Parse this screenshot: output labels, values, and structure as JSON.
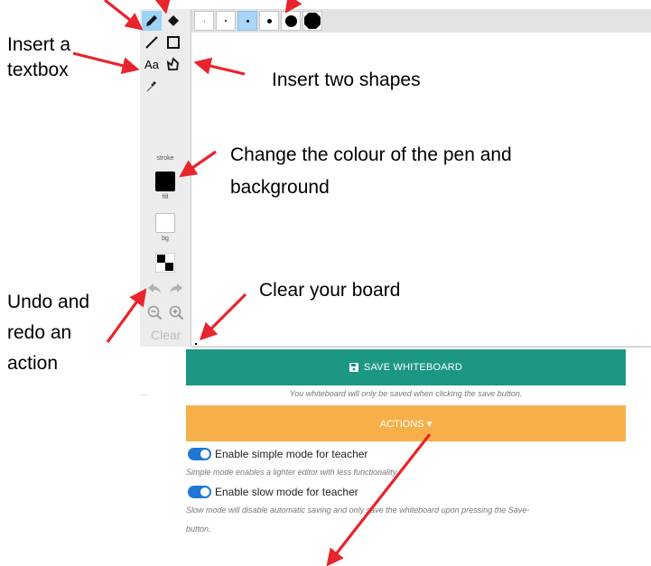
{
  "annotations": {
    "textbox": [
      "Insert a",
      "textbox"
    ],
    "shapes": "Insert two shapes",
    "colour": [
      "Change the colour of the pen and",
      "background"
    ],
    "undo": [
      "Undo and",
      "redo an",
      "action"
    ],
    "clear": "Clear your board"
  },
  "sidebar": {
    "text_tool": "Aa",
    "stroke_label": "stroke",
    "fill_label": "fill",
    "bg_label": "bg",
    "clear_label": "Clear",
    "stroke_color": "#000000",
    "bg_color": "#ffffff"
  },
  "brush_sizes": {
    "count": 6,
    "active_index": 2
  },
  "save": {
    "label": "SAVE WHITEBOARD",
    "note": "You whiteboard will only be saved when clicking the save button."
  },
  "actions": {
    "label": "ACTIONS ▾"
  },
  "options": [
    {
      "label": "Enable simple mode for teacher",
      "note": "Simple mode enables a lighter editor with less functionality.",
      "enabled": true
    },
    {
      "label": "Enable slow mode for teacher",
      "note_line1": "Slow mode will disable automatic saving and only save the whiteboard upon pressing the Save-",
      "note_line2": "button.",
      "enabled": true
    }
  ],
  "colors": {
    "save": "#1b9783",
    "actions": "#f7b049",
    "toggle": "#1e78d3",
    "arrow": "#e8242c"
  }
}
